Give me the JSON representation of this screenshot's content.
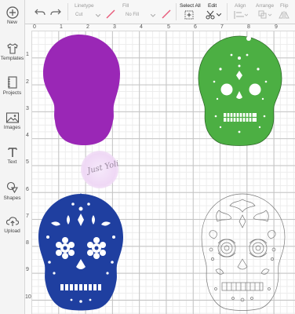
{
  "sidebar": {
    "items": [
      {
        "label": "New",
        "icon": "plus-circle-icon"
      },
      {
        "label": "Templates",
        "icon": "tshirt-icon"
      },
      {
        "label": "Projects",
        "icon": "notebook-icon"
      },
      {
        "label": "Images",
        "icon": "image-icon"
      },
      {
        "label": "Text",
        "icon": "text-T-icon"
      },
      {
        "label": "Shapes",
        "icon": "shapes-icon"
      },
      {
        "label": "Upload",
        "icon": "cloud-upload-icon"
      }
    ]
  },
  "toolbar": {
    "linetype_label": "Linetype",
    "linetype_value": "Cut",
    "fill_label": "Fill",
    "fill_value": "No Fill",
    "select_all_label": "Select All",
    "edit_label": "Edit",
    "align_label": "Align",
    "arrange_label": "Arrange",
    "flip_label": "Flip"
  },
  "ruler": {
    "top": [
      "0",
      "1",
      "2",
      "3",
      "4",
      "5",
      "6",
      "7",
      "8",
      "9"
    ],
    "left": [
      "1",
      "2",
      "3",
      "4",
      "5",
      "6",
      "7",
      "8",
      "9",
      "10"
    ]
  },
  "canvas": {
    "watermark_text": "Just Yoli",
    "skulls": [
      {
        "name": "purple",
        "color": "#9a27b6"
      },
      {
        "name": "green",
        "color": "#4caf43"
      },
      {
        "name": "blue",
        "color": "#1f3fa0"
      },
      {
        "name": "outline",
        "color": "#777777"
      }
    ]
  }
}
